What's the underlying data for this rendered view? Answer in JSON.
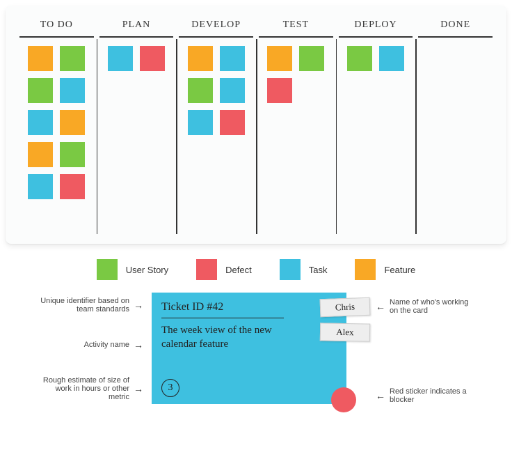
{
  "board": {
    "columns": [
      {
        "title": "TO DO",
        "cards": [
          "orange",
          "green",
          "green",
          "blue",
          "blue",
          "orange",
          "orange",
          "green",
          "blue",
          "red"
        ]
      },
      {
        "title": "PLAN",
        "cards": [
          "blue",
          "red"
        ]
      },
      {
        "title": "DEVELOP",
        "cards": [
          "orange",
          "blue",
          "green",
          "blue",
          "blue",
          "red"
        ]
      },
      {
        "title": "TEST",
        "cards": [
          "orange",
          "green",
          "red"
        ]
      },
      {
        "title": "DEPLOY",
        "cards": [
          "green",
          "blue"
        ]
      },
      {
        "title": "DONE",
        "cards": []
      }
    ]
  },
  "legend": [
    {
      "color": "green",
      "label": "User Story"
    },
    {
      "color": "red",
      "label": "Defect"
    },
    {
      "color": "blue",
      "label": "Task"
    },
    {
      "color": "orange",
      "label": "Feature"
    }
  ],
  "detail": {
    "ticket_id": "Ticket ID #42",
    "description": "The week view of the new calendar feature",
    "estimate": "3",
    "assignees": [
      "Chris",
      "Alex"
    ],
    "annotations": {
      "id": "Unique identifier based on team standards",
      "activity": "Activity name",
      "estimate": "Rough estimate of size of work in hours or other metric",
      "assignee": "Name of who's working on the card",
      "blocker": "Red sticker indicates a blocker"
    }
  }
}
